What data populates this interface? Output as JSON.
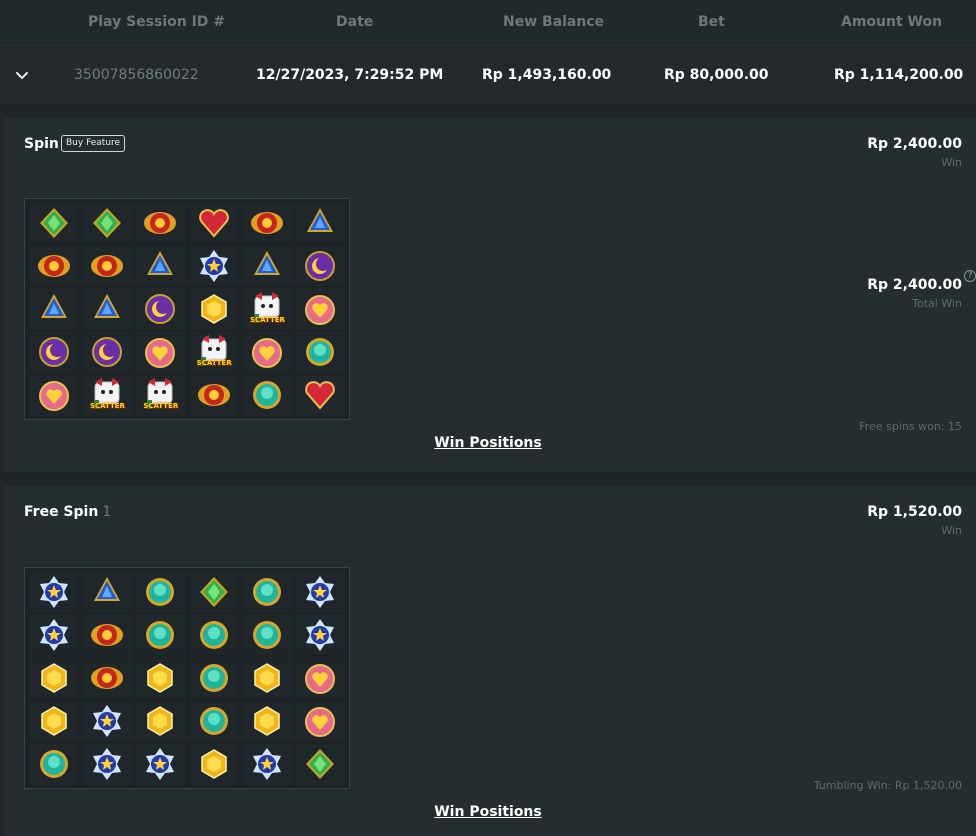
{
  "table": {
    "headers": {
      "session_id": "Play Session ID #",
      "date": "Date",
      "new_balance": "New Balance",
      "bet": "Bet",
      "amount_won": "Amount Won"
    },
    "row": {
      "session_id": "35007856860022",
      "date": "12/27/2023, 7:29:52 PM",
      "new_balance": "Rp 1,493,160.00",
      "bet": "Rp 80,000.00",
      "amount_won": "Rp 1,114,200.00"
    }
  },
  "spin": {
    "title": "Spin",
    "badge": "Buy Feature",
    "win_amount": "Rp 2,400.00",
    "win_label": "Win",
    "total_win_amount": "Rp 2,400.00",
    "total_win_label": "Total Win",
    "help_glyph": "?",
    "free_spins_note": "Free spins won: 15",
    "win_positions": "Win Positions",
    "scatter_text": "SCATTER",
    "grid": [
      [
        "green-gem",
        "green-gem",
        "sun",
        "red-heart",
        "sun",
        "blue-gem"
      ],
      [
        "sun",
        "sun",
        "blue-gem",
        "star",
        "blue-gem",
        "purple-moon"
      ],
      [
        "blue-gem",
        "blue-gem",
        "purple-moon",
        "yellow-gem",
        "scatter",
        "pink-heart"
      ],
      [
        "purple-moon",
        "purple-moon",
        "pink-heart",
        "scatter",
        "pink-heart",
        "teal-gem"
      ],
      [
        "pink-heart",
        "scatter",
        "scatter",
        "sun",
        "teal-gem",
        "red-heart"
      ]
    ]
  },
  "free_spin": {
    "title": "Free Spin",
    "number": "1",
    "win_amount": "Rp 1,520.00",
    "win_label": "Win",
    "tumbling_note": "Tumbling Win: Rp 1,520.00",
    "win_positions": "Win Positions",
    "grid": [
      [
        "star",
        "blue-gem",
        "teal-gem",
        "green-gem",
        "teal-gem",
        "star"
      ],
      [
        "star",
        "sun",
        "teal-gem",
        "teal-gem",
        "teal-gem",
        "star"
      ],
      [
        "yellow-gem",
        "sun",
        "yellow-gem",
        "teal-gem",
        "yellow-gem",
        "pink-heart"
      ],
      [
        "yellow-gem",
        "star",
        "yellow-gem",
        "teal-gem",
        "yellow-gem",
        "pink-heart"
      ],
      [
        "teal-gem",
        "star",
        "star",
        "yellow-gem",
        "star",
        "green-gem"
      ]
    ]
  },
  "colors": {
    "background": "#1f2528",
    "panel": "#262d30",
    "muted_text": "#6d777c"
  }
}
